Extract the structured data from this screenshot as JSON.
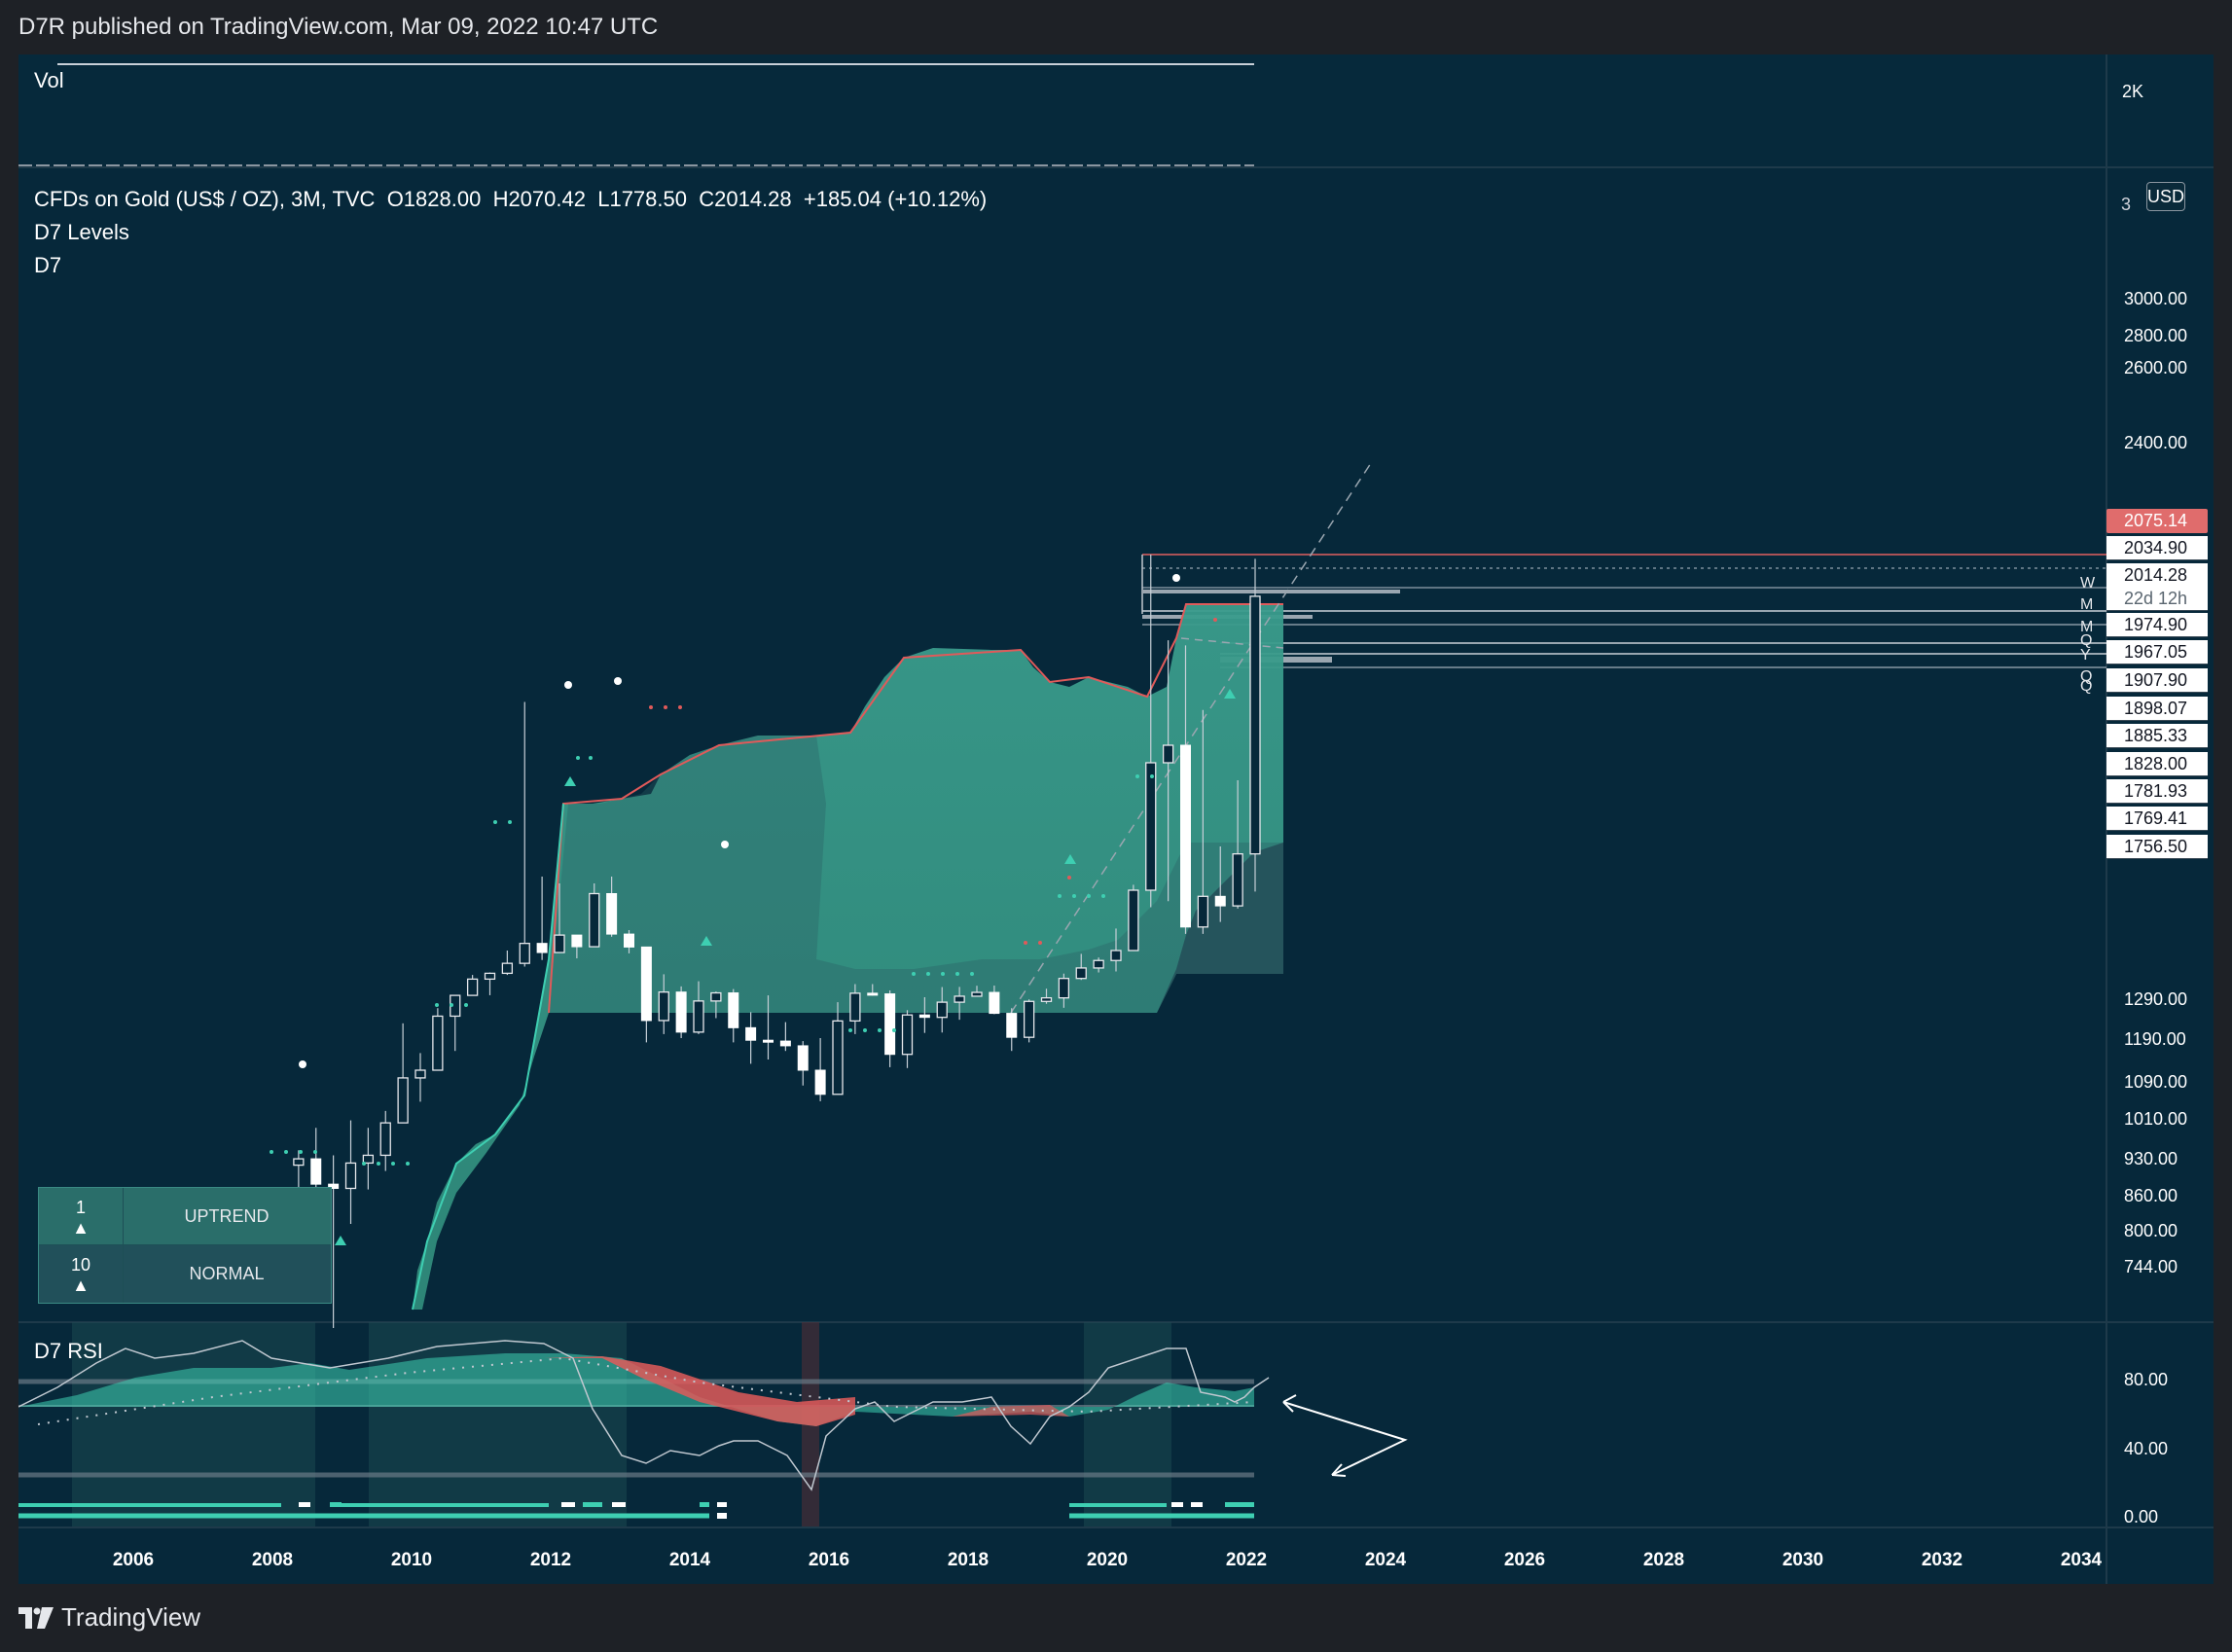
{
  "header": {
    "published": "D7R published on TradingView.com, Mar 09, 2022 10:47 UTC"
  },
  "footer": {
    "brand": "TradingView"
  },
  "vol_pane": {
    "label": "Vol",
    "axis_label": "2K"
  },
  "main_pane": {
    "symbol": "CFDs on Gold (US$ / OZ), 3M, TVC",
    "ohlc": {
      "o": "O1828.00",
      "h": "H2070.42",
      "l": "L1778.50",
      "c": "C2014.28",
      "chg": "+185.04 (+10.12%)"
    },
    "indicators": [
      "D7 Levels",
      "D7"
    ],
    "currency": "USD",
    "partial_top_tick": "3",
    "price_tags": [
      {
        "text": "2075.14",
        "style": "red"
      },
      {
        "text": "2034.90",
        "style": "white"
      },
      {
        "text": "2014.28",
        "style": "white"
      },
      {
        "text": "22d 12h",
        "style": "white"
      },
      {
        "text": "1974.90",
        "style": "white"
      },
      {
        "text": "1967.05",
        "style": "white"
      },
      {
        "text": "1907.90",
        "style": "white"
      },
      {
        "text": "1898.07",
        "style": "white"
      },
      {
        "text": "1885.33",
        "style": "white"
      },
      {
        "text": "1828.00",
        "style": "white"
      },
      {
        "text": "1781.93",
        "style": "white"
      },
      {
        "text": "1769.41",
        "style": "white"
      },
      {
        "text": "1756.50",
        "style": "white"
      }
    ],
    "level_letters": [
      "W",
      "M",
      "M",
      "Q",
      "Y",
      "Q",
      "Q"
    ],
    "table": [
      {
        "num": "1",
        "arrow": "▲",
        "label": "UPTREND"
      },
      {
        "num": "10",
        "arrow": "▲",
        "label": "NORMAL"
      }
    ]
  },
  "rsi_pane": {
    "label": "D7 RSI",
    "ticks": [
      "80.00",
      "40.00",
      "0.00"
    ]
  },
  "colors": {
    "bg": "#06283a",
    "accent": "#3ecfb2",
    "cloud": "#3a9a8a",
    "bear": "#e05a5a"
  },
  "chart_data": [
    {
      "type": "candlestick",
      "title": "CFDs on Gold (US$ / OZ), 3M, TVC",
      "y_scale": "log",
      "y_ticks": [
        3000,
        2800,
        2600,
        2400,
        1290,
        1190,
        1090,
        1010,
        930,
        860,
        800,
        744
      ],
      "x_ticks": [
        "2006",
        "2008",
        "2010",
        "2012",
        "2014",
        "2016",
        "2018",
        "2020",
        "2022",
        "2024",
        "2026",
        "2028",
        "2030",
        "2032",
        "2034"
      ],
      "x": [
        "2008Q2",
        "2008Q3",
        "2008Q4",
        "2009Q1",
        "2009Q2",
        "2009Q3",
        "2009Q4",
        "2010Q1",
        "2010Q2",
        "2010Q3",
        "2010Q4",
        "2011Q1",
        "2011Q2",
        "2011Q3",
        "2011Q4",
        "2012Q1",
        "2012Q2",
        "2012Q3",
        "2012Q4",
        "2013Q1",
        "2013Q2",
        "2013Q3",
        "2013Q4",
        "2014Q1",
        "2014Q2",
        "2014Q3",
        "2014Q4",
        "2015Q1",
        "2015Q2",
        "2015Q3",
        "2015Q4",
        "2016Q1",
        "2016Q2",
        "2016Q3",
        "2016Q4",
        "2017Q1",
        "2017Q2",
        "2017Q3",
        "2017Q4",
        "2018Q1",
        "2018Q2",
        "2018Q3",
        "2018Q4",
        "2019Q1",
        "2019Q2",
        "2019Q3",
        "2019Q4",
        "2020Q1",
        "2020Q2",
        "2020Q3",
        "2020Q4",
        "2021Q1",
        "2021Q2",
        "2021Q3",
        "2021Q4",
        "2022Q1"
      ],
      "open": [
        916,
        928,
        880,
        872,
        920,
        935,
        1000,
        1097,
        1115,
        1245,
        1307,
        1405,
        1440,
        1500,
        1620,
        1565,
        1670,
        1600,
        1775,
        1676,
        1598,
        1234,
        1327,
        1205,
        1283,
        1322,
        1216,
        1185,
        1183,
        1172,
        1115,
        1061,
        1233,
        1320,
        1316,
        1152,
        1248,
        1242,
        1280,
        1302,
        1325,
        1252,
        1192,
        1282,
        1292,
        1409,
        1472,
        1517,
        1577,
        1780,
        1886,
        1895,
        1708,
        1771,
        1757,
        1828
      ],
      "high": [
        945,
        990,
        935,
        1005,
        990,
        1025,
        1227,
        1155,
        1265,
        1310,
        1430,
        1445,
        1577,
        1921,
        1800,
        1790,
        1630,
        1790,
        1800,
        1700,
        1550,
        1434,
        1361,
        1392,
        1330,
        1345,
        1255,
        1307,
        1230,
        1183,
        1190,
        1280,
        1375,
        1375,
        1337,
        1260,
        1296,
        1357,
        1358,
        1365,
        1366,
        1265,
        1287,
        1347,
        1438,
        1557,
        1535,
        1704,
        1788,
        2075,
        1965,
        1960,
        1916,
        1834,
        1877,
        2070
      ],
      "low": [
        862,
        740,
        681,
        810,
        870,
        905,
        1000,
        1045,
        1115,
        1160,
        1305,
        1308,
        1430,
        1480,
        1520,
        1625,
        1530,
        1600,
        1660,
        1560,
        1180,
        1200,
        1190,
        1200,
        1240,
        1180,
        1130,
        1140,
        1160,
        1080,
        1046,
        1061,
        1200,
        1305,
        1122,
        1120,
        1203,
        1204,
        1236,
        1306,
        1250,
        1160,
        1180,
        1276,
        1266,
        1400,
        1445,
        1451,
        1577,
        1755,
        1764,
        1677,
        1677,
        1721,
        1753,
        1778
      ],
      "close": [
        928,
        880,
        872,
        920,
        935,
        1000,
        1097,
        1115,
        1245,
        1307,
        1405,
        1440,
        1500,
        1620,
        1565,
        1670,
        1600,
        1775,
        1676,
        1598,
        1234,
        1327,
        1205,
        1283,
        1322,
        1216,
        1185,
        1183,
        1172,
        1115,
        1061,
        1233,
        1320,
        1316,
        1152,
        1248,
        1242,
        1280,
        1302,
        1325,
        1252,
        1192,
        1282,
        1292,
        1409,
        1472,
        1517,
        1577,
        1780,
        1886,
        1895,
        1708,
        1771,
        1757,
        1828,
        2014
      ]
    },
    {
      "type": "line",
      "title": "D7 RSI",
      "y_ticks": [
        80,
        40,
        0
      ]
    }
  ]
}
